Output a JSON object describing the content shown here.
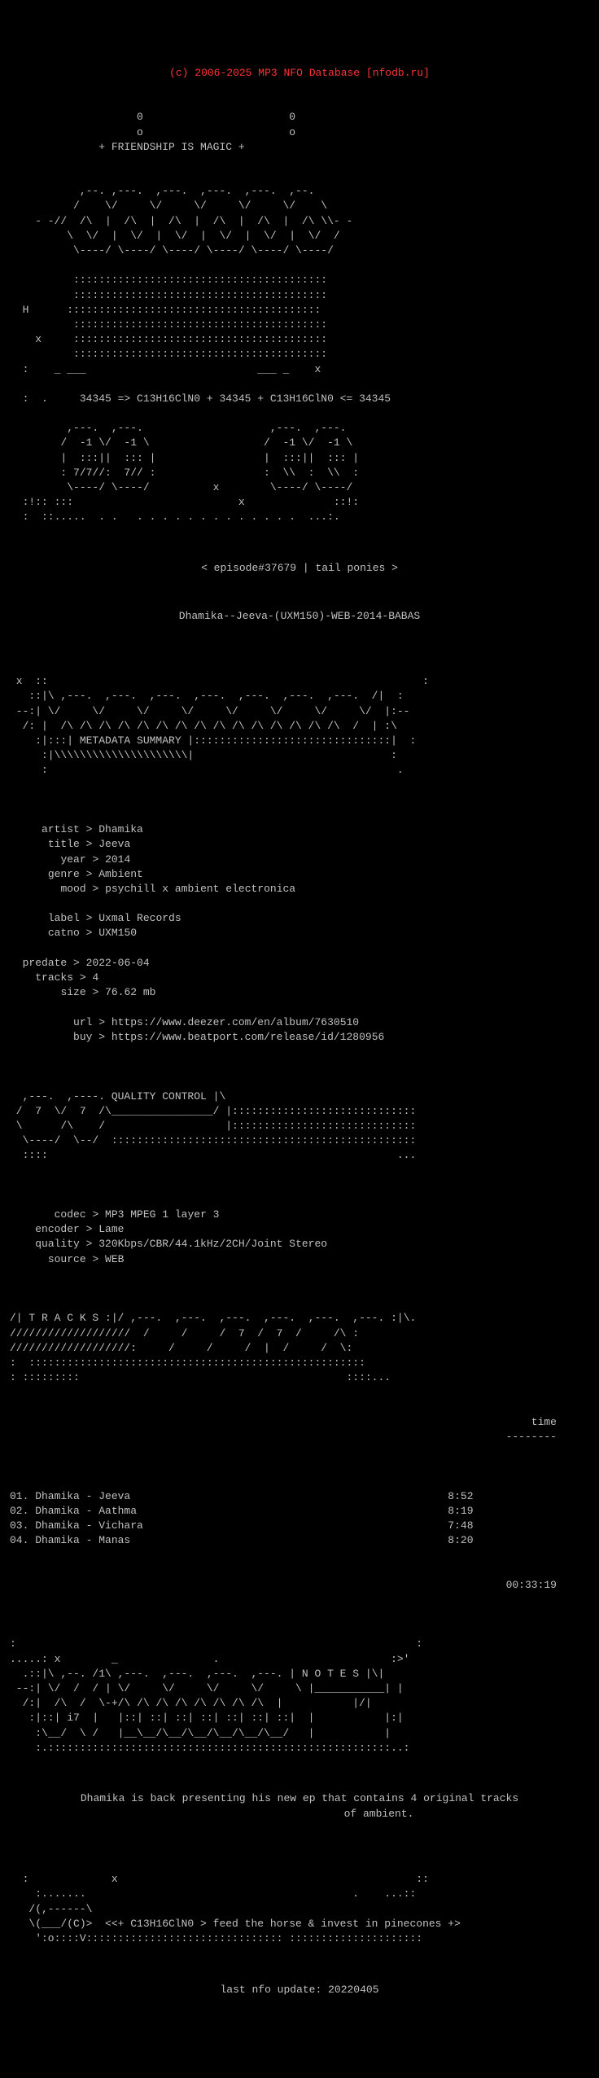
{
  "header": {
    "copyright": "(c) 2006-2025 MP3 NFO Database [nfodb.ru]"
  },
  "ascii_art_1": "                    0                       0\n                    o                       o\n              + FRIENDSHIP IS MAGIC +\n\n\n\n           ,--.  ,---.   ,---.  ,---.  ,---.  ,--.\n          /    \\/     \\ /     \\/     \\/     \\/    \\\n    - -//  /\\  |  /\\  |  /\\  |  /\\  |  /\\  |  /\\ \\\\- -\n        \\  \\/  |  \\/  |  \\/  |  \\/  |  \\/  |  \\/  /\n         \\----/ \\----/ \\----/ \\----/ \\----/ \\----/\n\n          ::::::::::::::::::::::::::::::::::::::::\n          ::::::::::::::::::::::::::::::::::::::::\n  H      ::::::::::::::::::::::::::::::::::::::::\n          ::::::::::::::::::::::::::::::::::::::::\n    x     ::::::::::::::::::::::::::::::::::::::::\n          ::::::::::::::::::::::::::::::::::::::::\n  :    _ ___                           ___ _     x\n\n  :  .     34345 => C13H16ClN0 + 34345 + C13H16ClN0 <= 34345\n\n         ,---.  ,---.                    ,---.  ,---.\n        /  -1 \\/  -1 \\                  /  -1 \\/  -1 \\\n        |  :::||  ::: |                 |  :::||  ::: |\n        : 7/7//:  7// :                 :  \\\\  :  \\\\  :\n         \\----/ \\----/          x        \\----/ \\----/\n  :!:: :::                          x              ::!:\n  :  ::.....  . .   . . . . . . . . . . . . .  ...:.",
  "episode_line": "< episode#37679 | tail ponies >",
  "release_name": "Dhamika--Jeeva-(UXM150)-WEB-2014-BABAS",
  "ascii_art_2": "\n x  ::                                                           :\n   ::|\\   ,---.  ,---.  ,---.  ,---.  ,---.  ,---.  ,---. /|  :\n  --:|  \\/     \\/     \\/     \\/     \\/     \\/     \\/     \\/  |:--\n  /: |  /\\  /\\  /\\  /\\  /\\  /\\  /\\  /\\  /\\  /\\  /\\  /\\  /  | :\\  \n    :|:::| METADATA SUMMARY |:::::::::::::::::::::::::::::::|  :\n     :|\\\\\\\\\\\\\\\\\\\\\\\\\\\\\\\\\\\\\\\\\\|                               :\n     :                                                       .",
  "metadata": {
    "artist_label": "artist",
    "artist_value": "Dhamika",
    "title_label": "title",
    "title_value": "Jeeva",
    "year_label": "year",
    "year_value": "2014",
    "genre_label": "genre",
    "genre_value": "Ambient",
    "mood_label": "mood",
    "mood_value": "psychill x ambient electronica",
    "label_label": "label",
    "label_value": "Uxmal Records",
    "catno_label": "catno",
    "catno_value": "UXM150",
    "predate_label": "predate",
    "predate_value": "2022-06-04",
    "tracks_label": "tracks",
    "tracks_value": "4",
    "size_label": "size",
    "size_value": "76.62 mb",
    "url_label": "url",
    "url_value": "https://www.deezer.com/en/album/7630510",
    "buy_label": "buy",
    "buy_value": "https://www.beatport.com/release/id/1280956"
  },
  "ascii_art_3": "\n ,---.  ,----.  QUALITY CONTROL  |\\.\n/  7  \\/  7  /\\_________________/ |:::::::::::::::::::::::::::\n\\      /\\    /                    |:::::::::::::::::::::::::::\n \\----/  \\--/  ::::::::::::::::::::::::::::::::::::::::::::::\n ::::                                                      ...",
  "quality": {
    "codec_label": "codec",
    "codec_value": "MP3 MPEG 1 layer 3",
    "encoder_label": "encoder",
    "encoder_value": "Lame",
    "quality_label": "quality",
    "quality_value": "320Kbps/CBR/44.1kHz/2CH/Joint Stereo",
    "source_label": "source",
    "source_value": "WEB"
  },
  "ascii_art_4": "\n/| T R A C K S :|/  ,---.  ,---.  ,---.  ,---.  ,---. :|\\.\n////////////////////  /     /     /  7  /  7  /     /\\ :\n/////////////////////:     /     /     /  |  /     /  \\:\n:  :::::::::::::::::::::::::::::::::::::::::::::::::::::\n: :::::::::                                          :::..",
  "tracks_header": {
    "time_label": "time",
    "separator": "--------"
  },
  "tracks": [
    {
      "number": "01",
      "artist": "Dhamika",
      "title": "Jeeva",
      "time": "8:52"
    },
    {
      "number": "02",
      "artist": "Dhamika",
      "title": "Aathma",
      "time": "8:19"
    },
    {
      "number": "03",
      "artist": "Dhamika",
      "title": "Vichara",
      "time": "7:48"
    },
    {
      "number": "04",
      "artist": "Dhamika",
      "title": "Manas",
      "time": "8:20"
    }
  ],
  "total_time": "00:33:19",
  "ascii_art_5": "\n:                                                               :\n.....: x        _               .                           :>'\n  .::|\\   ,--. /1\\  ,---.  ,---.  ,---.  ,---. | N O T E S |\\|\n --:| \\/  /   / | \\/     \\/     \\/     \\/     \\ |___________| |\n  /:|  /\\  /  \\-+/\\  /\\  /\\  /\\  /\\  /\\  /\\   |           |/|\n   :|::| i7  |   |::| ::| ::| ::| ::| ::| ::|  |           |:|\n    :\\__/  \\ /   |__\\__/\\__/\\__/\\__/\\__/\\__/   |           |\n    :.:::::::::::::::::::::::::::::::::::::::::::::::::::::::..:",
  "notes": "Dhamika is back presenting his new ep that contains 4 original tracks\n                         of ambient.",
  "ascii_art_6": "\n  :             x                                               ::\n    :.......                                          .    ...::.\n   /(,------\\                                                   \n   \\(___/(C)>  <<+ C13H16ClN0 > feed the horse & invest in pinecones +>\n    ':o::::V::::::::::::::::::::::::::::::: :::::::::::::::::::::",
  "footer": "last nfo update: 20220405"
}
